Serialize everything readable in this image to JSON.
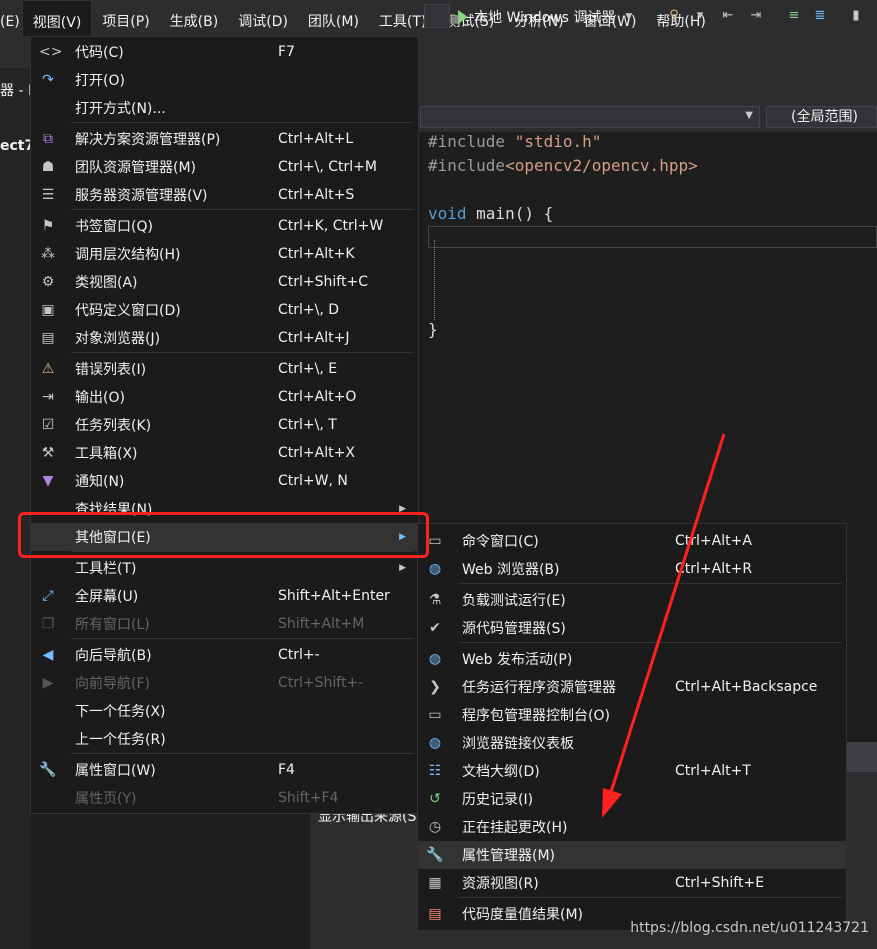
{
  "menubar": {
    "items": [
      "(E)",
      "视图(V)",
      "项目(P)",
      "生成(B)",
      "调试(D)",
      "团队(M)",
      "工具(T)",
      "测试(S)",
      "分析(N)",
      "窗口(W)",
      "帮助(H)"
    ]
  },
  "toolbar": {
    "run_label": "本地 Windows 调试器"
  },
  "left": {
    "frag1": "器 - P",
    "frag2": "ect7"
  },
  "editor": {
    "scope": "(全局范围)",
    "lines": {
      "l1a": "#include ",
      "l1b": "\"stdio.h\"",
      "l2a": "#include",
      "l2b": "<opencv2/opencv.hpp>",
      "l3a": "void",
      "l3b": " main() {",
      "l4": "}"
    }
  },
  "bottom": {
    "label": "显示输出来源(S"
  },
  "view_menu": [
    {
      "icon": "code-icon",
      "label": "代码(C)",
      "shortcut": "F7"
    },
    {
      "icon": "open-icon",
      "label": "打开(O)",
      "shortcut": ""
    },
    {
      "icon": "",
      "label": "打开方式(N)...",
      "shortcut": ""
    },
    {
      "icon": "solution-explorer-icon",
      "label": "解决方案资源管理器(P)",
      "shortcut": "Ctrl+Alt+L"
    },
    {
      "icon": "team-explorer-icon",
      "label": "团队资源管理器(M)",
      "shortcut": "Ctrl+\\, Ctrl+M"
    },
    {
      "icon": "server-explorer-icon",
      "label": "服务器资源管理器(V)",
      "shortcut": "Ctrl+Alt+S"
    },
    {
      "icon": "bookmark-window-icon",
      "label": "书签窗口(Q)",
      "shortcut": "Ctrl+K, Ctrl+W"
    },
    {
      "icon": "call-hierarchy-icon",
      "label": "调用层次结构(H)",
      "shortcut": "Ctrl+Alt+K"
    },
    {
      "icon": "class-view-icon",
      "label": "类视图(A)",
      "shortcut": "Ctrl+Shift+C"
    },
    {
      "icon": "code-definition-icon",
      "label": "代码定义窗口(D)",
      "shortcut": "Ctrl+\\, D"
    },
    {
      "icon": "object-browser-icon",
      "label": "对象浏览器(J)",
      "shortcut": "Ctrl+Alt+J"
    },
    {
      "icon": "error-list-icon",
      "label": "错误列表(I)",
      "shortcut": "Ctrl+\\, E"
    },
    {
      "icon": "output-icon",
      "label": "输出(O)",
      "shortcut": "Ctrl+Alt+O"
    },
    {
      "icon": "task-list-icon",
      "label": "任务列表(K)",
      "shortcut": "Ctrl+\\, T"
    },
    {
      "icon": "toolbox-icon",
      "label": "工具箱(X)",
      "shortcut": "Ctrl+Alt+X"
    },
    {
      "icon": "notification-icon",
      "label": "通知(N)",
      "shortcut": "Ctrl+W, N"
    },
    {
      "icon": "",
      "label": "查找结果(N)",
      "shortcut": ""
    },
    {
      "icon": "",
      "label": "其他窗口(E)",
      "shortcut": ""
    },
    {
      "icon": "",
      "label": "工具栏(T)",
      "shortcut": ""
    },
    {
      "icon": "fullscreen-icon",
      "label": "全屏幕(U)",
      "shortcut": "Shift+Alt+Enter"
    },
    {
      "icon": "all-windows-icon",
      "label": "所有窗口(L)",
      "shortcut": "Shift+Alt+M"
    },
    {
      "icon": "navigate-back-icon",
      "label": "向后导航(B)",
      "shortcut": "Ctrl+-"
    },
    {
      "icon": "navigate-forward-icon",
      "label": "向前导航(F)",
      "shortcut": "Ctrl+Shift+-"
    },
    {
      "icon": "",
      "label": "下一个任务(X)",
      "shortcut": ""
    },
    {
      "icon": "",
      "label": "上一个任务(R)",
      "shortcut": ""
    },
    {
      "icon": "wrench-icon",
      "label": "属性窗口(W)",
      "shortcut": "F4"
    },
    {
      "icon": "",
      "label": "属性页(Y)",
      "shortcut": "Shift+F4"
    }
  ],
  "other_menu": [
    {
      "icon": "command-window-icon",
      "label": "命令窗口(C)",
      "shortcut": "Ctrl+Alt+A"
    },
    {
      "icon": "web-browser-icon",
      "label": "Web 浏览器(B)",
      "shortcut": "Ctrl+Alt+R"
    },
    {
      "icon": "load-test-icon",
      "label": "负载测试运行(E)",
      "shortcut": ""
    },
    {
      "icon": "source-control-icon",
      "label": "源代码管理器(S)",
      "shortcut": ""
    },
    {
      "icon": "web-publish-icon",
      "label": "Web 发布活动(P)",
      "shortcut": ""
    },
    {
      "icon": "chevron-right-icon",
      "label": "任务运行程序资源管理器",
      "shortcut": "Ctrl+Alt+Backsapce"
    },
    {
      "icon": "package-console-icon",
      "label": "程序包管理器控制台(O)",
      "shortcut": ""
    },
    {
      "icon": "browser-link-icon",
      "label": "浏览器链接仪表板",
      "shortcut": ""
    },
    {
      "icon": "document-outline-icon",
      "label": "文档大纲(D)",
      "shortcut": "Ctrl+Alt+T"
    },
    {
      "icon": "history-icon",
      "label": "历史记录(I)",
      "shortcut": ""
    },
    {
      "icon": "pending-changes-icon",
      "label": "正在挂起更改(H)",
      "shortcut": ""
    },
    {
      "icon": "wrench-icon",
      "label": "属性管理器(M)",
      "shortcut": ""
    },
    {
      "icon": "resource-view-icon",
      "label": "资源视图(R)",
      "shortcut": "Ctrl+Shift+E"
    },
    {
      "icon": "code-metrics-icon",
      "label": "代码度量值结果(M)",
      "shortcut": ""
    }
  ],
  "watermark": "https://blog.csdn.net/u011243721"
}
